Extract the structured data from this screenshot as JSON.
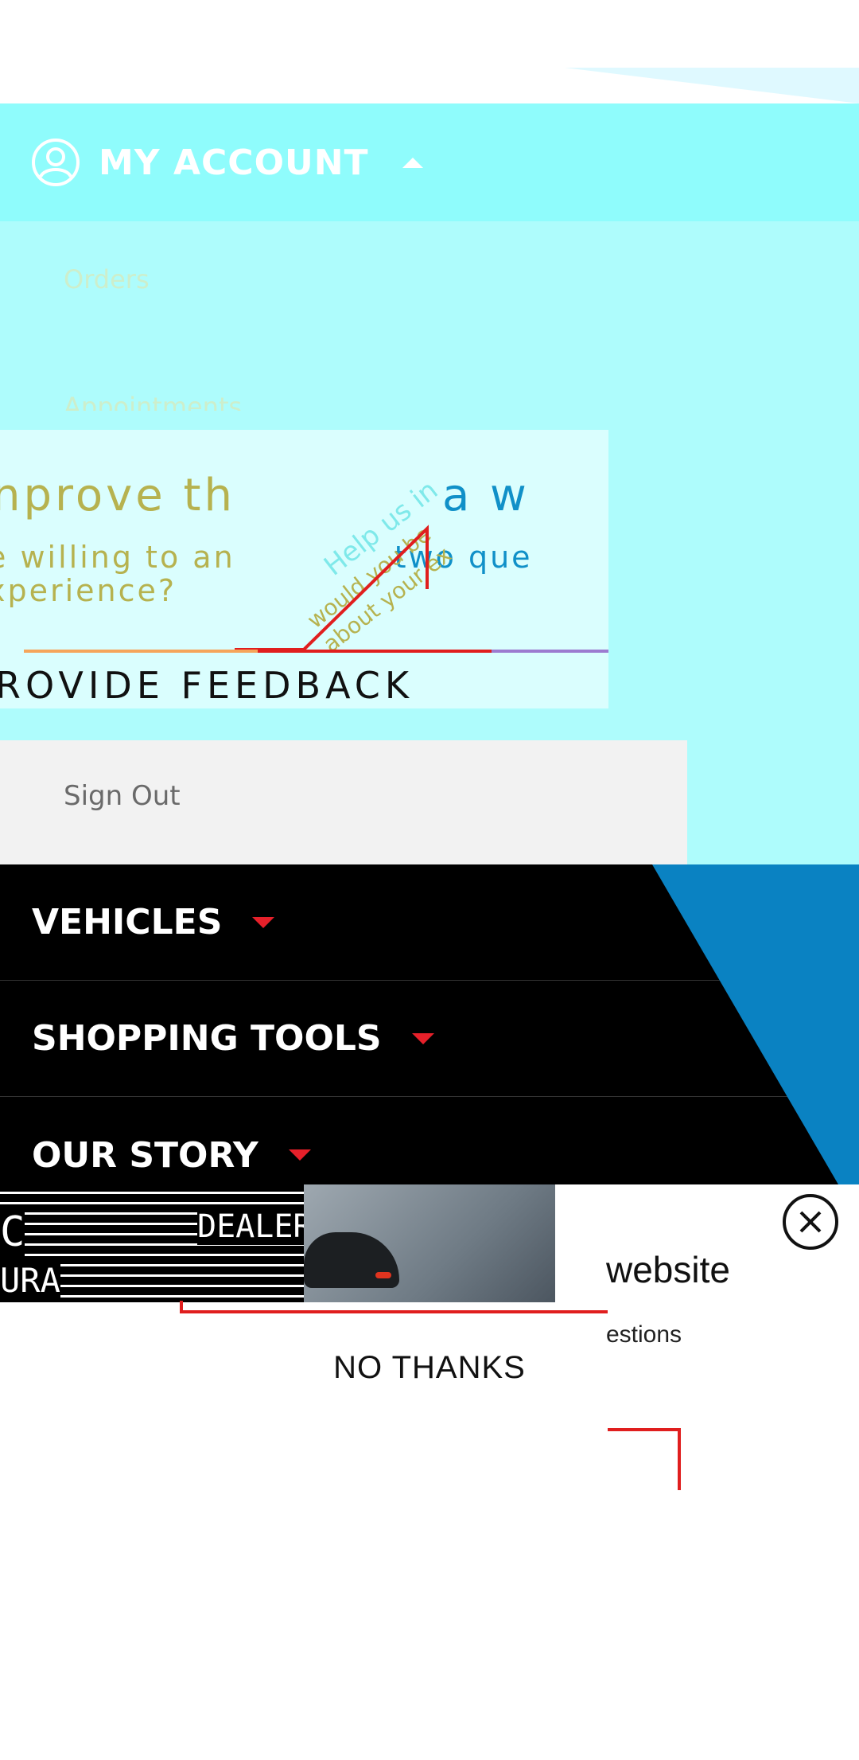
{
  "account": {
    "title": "MY ACCOUNT",
    "items": [
      "Orders",
      "Appointments"
    ],
    "sign_out": "Sign Out"
  },
  "survey": {
    "line1": "nprove th",
    "line1_end": "a w",
    "line2": "e willing to an",
    "line2_end": "two que",
    "line3": "xperience?",
    "rotated_a": "Help us in",
    "rotated_b": "would you be",
    "rotated_c": "about your ex",
    "cta": "ROVIDE FEEDBACK"
  },
  "nav": {
    "items": [
      "VEHICLES",
      "SHOPPING TOOLS",
      "OUR STORY"
    ]
  },
  "popup": {
    "logo_top": "C",
    "logo_mid": "DEALERS",
    "logo_bottom": "URA",
    "title": "website",
    "subtitle": "estions",
    "dismiss": "NO THANKS"
  },
  "colors": {
    "account_header": "#8ffcfc",
    "nav_bg": "#000000",
    "accent_red": "#e6202a",
    "accent_blue": "#0a82c2"
  },
  "icons": {
    "account": "user-circle-icon",
    "expand": "chevron-up-icon",
    "nav_caret": "caret-down-icon",
    "close": "close-circle-icon"
  }
}
